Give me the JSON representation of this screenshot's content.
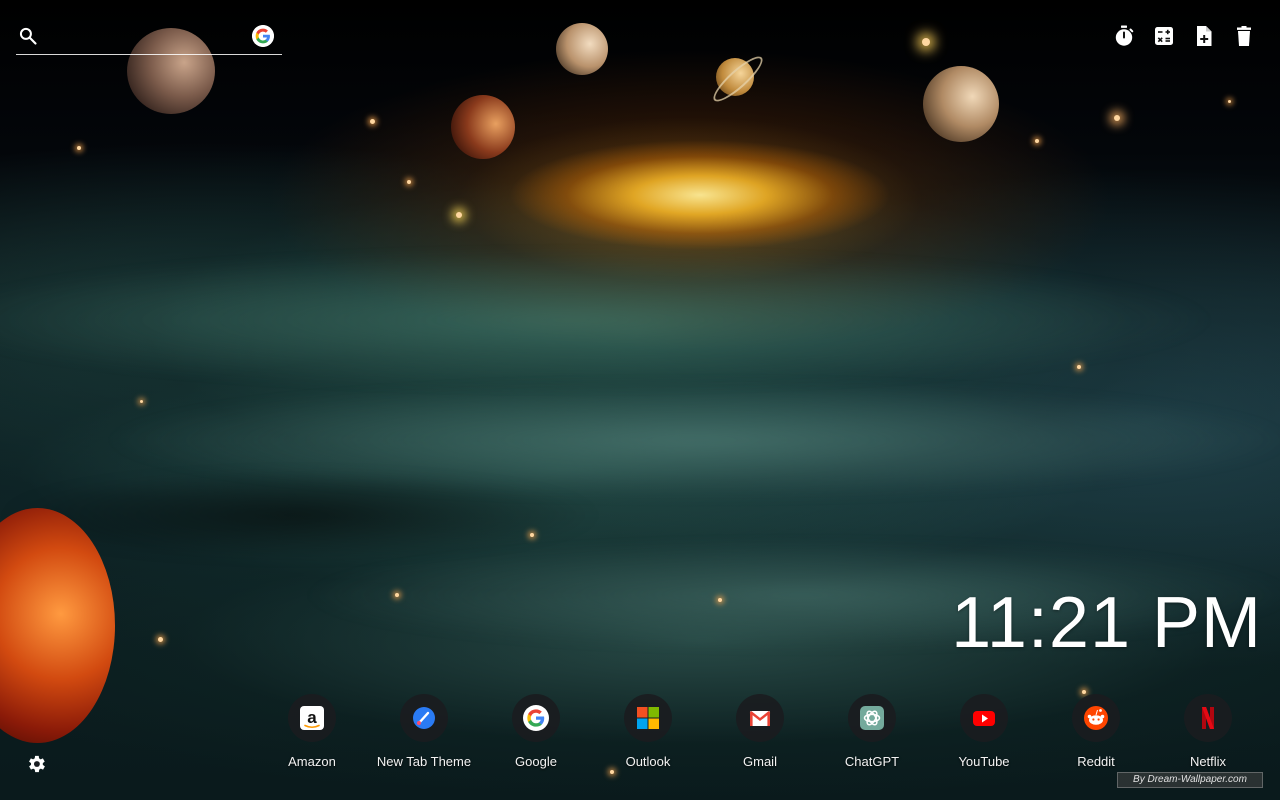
{
  "search": {
    "placeholder": "",
    "value": ""
  },
  "toolbar": {
    "items": [
      {
        "name": "timer-icon"
      },
      {
        "name": "calculator-icon"
      },
      {
        "name": "add-note-icon"
      },
      {
        "name": "trash-icon"
      }
    ]
  },
  "clock": {
    "time": "11:21 PM"
  },
  "shortcuts": [
    {
      "label": "Amazon",
      "icon": "amazon-icon"
    },
    {
      "label": "New Tab Theme",
      "icon": "new-tab-theme-icon"
    },
    {
      "label": "Google",
      "icon": "google-icon"
    },
    {
      "label": "Outlook",
      "icon": "outlook-icon"
    },
    {
      "label": "Gmail",
      "icon": "gmail-icon"
    },
    {
      "label": "ChatGPT",
      "icon": "chatgpt-icon"
    },
    {
      "label": "YouTube",
      "icon": "youtube-icon"
    },
    {
      "label": "Reddit",
      "icon": "reddit-icon"
    },
    {
      "label": "Netflix",
      "icon": "netflix-icon"
    }
  ],
  "credit": {
    "text": "By Dream-Wallpaper.com"
  },
  "colors": {
    "google_blue": "#4285F4",
    "google_red": "#EA4335",
    "google_yellow": "#FBBC05",
    "google_green": "#34A853",
    "youtube_red": "#FF0000",
    "netflix_red": "#E50914",
    "reddit_orange": "#FF4500",
    "shortcut_bg": "#1a1c20"
  }
}
